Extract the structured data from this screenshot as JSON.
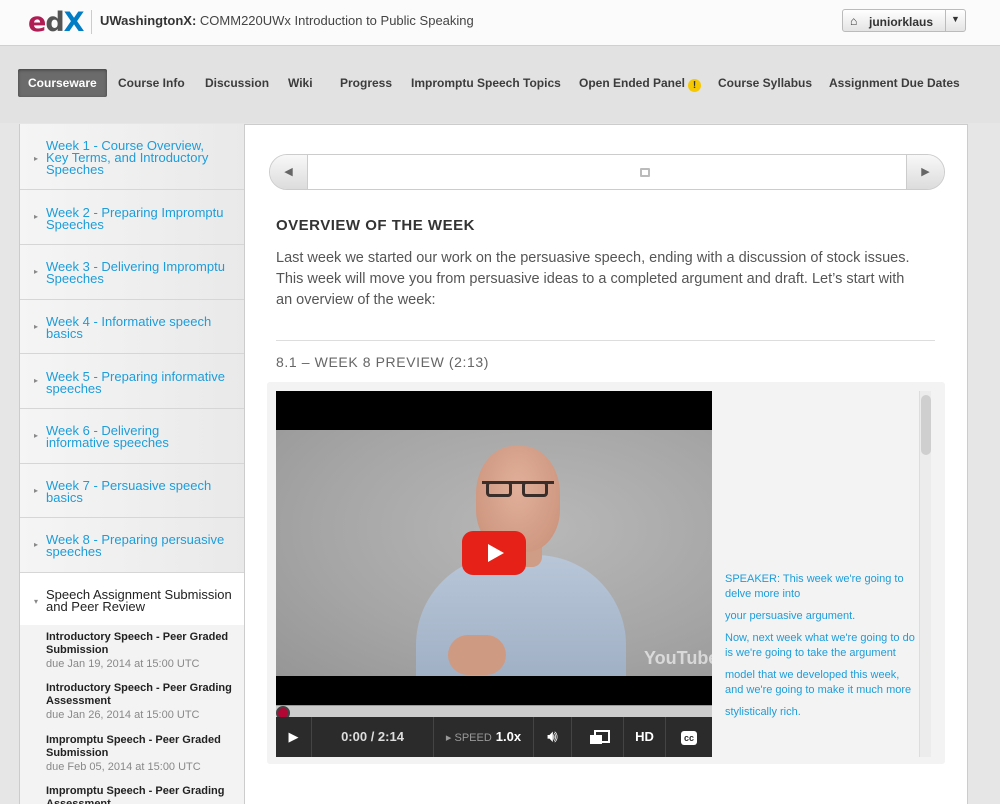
{
  "header": {
    "logo_e": "e",
    "logo_d": "d",
    "logo_x": "X",
    "org": "UWashingtonX:",
    "course": "COMM220UWx Introduction to Public Speaking",
    "username": "juniorklaus"
  },
  "nav": {
    "tabs": [
      {
        "label": "Courseware"
      },
      {
        "label": "Course Info"
      },
      {
        "label": "Discussion"
      },
      {
        "label": "Wiki"
      },
      {
        "label": "Progress"
      },
      {
        "label": "Impromptu Speech Topics"
      },
      {
        "label": "Open Ended Panel"
      },
      {
        "label": "Course Syllabus"
      },
      {
        "label": "Assignment Due Dates"
      }
    ],
    "warning_glyph": "!"
  },
  "sidebar": {
    "chapters": [
      {
        "label": "Week 1 - Course Overview, Key Terms, and Introductory Speeches"
      },
      {
        "label": "Week 2 - Preparing Impromptu Speeches"
      },
      {
        "label": "Week 3 - Delivering Impromptu Speeches"
      },
      {
        "label": "Week 4 - Informative speech basics"
      },
      {
        "label": "Week 5 - Preparing informative speeches"
      },
      {
        "label": "Week 6 - Delivering informative speeches"
      },
      {
        "label": "Week 7 - Persuasive speech basics"
      },
      {
        "label": "Week 8 - Preparing persuasive speeches"
      },
      {
        "label": "Speech Assignment Submission and Peer Review"
      }
    ],
    "sections": [
      {
        "title": "Introductory Speech - Peer Graded Submission",
        "due": "due Jan 19, 2014 at 15:00 UTC"
      },
      {
        "title": "Introductory Speech - Peer Grading Assessment",
        "due": "due Jan 26, 2014 at 15:00 UTC"
      },
      {
        "title": "Impromptu Speech - Peer Graded Submission",
        "due": "due Feb 05, 2014 at 15:00 UTC"
      },
      {
        "title": "Impromptu Speech - Peer Grading Assessment",
        "due": ""
      }
    ]
  },
  "main": {
    "overview_heading": "OVERVIEW OF THE WEEK",
    "intro": "Last week we started our work on the persuasive speech, ending with a discussion of stock issues. This week will move you from persuasive ideas to a completed argument and draft. Let’s start with an overview of the week:",
    "video_heading": "8.1 – WEEK 8 PREVIEW (2:13)"
  },
  "video": {
    "time": "0:00 / 2:14",
    "speed_label": "SPEED",
    "speed_value": "1.0x",
    "hd_label": "HD",
    "cc_label": "cc",
    "watermark": "YouTube",
    "progress": 0
  },
  "transcript": [
    "SPEAKER: This week we're going to delve more into",
    "your persuasive argument.",
    "Now, next week what we're going to do is we're going to take the argument",
    "model that we developed this week, and we're going to make it much more",
    "stylistically rich."
  ]
}
